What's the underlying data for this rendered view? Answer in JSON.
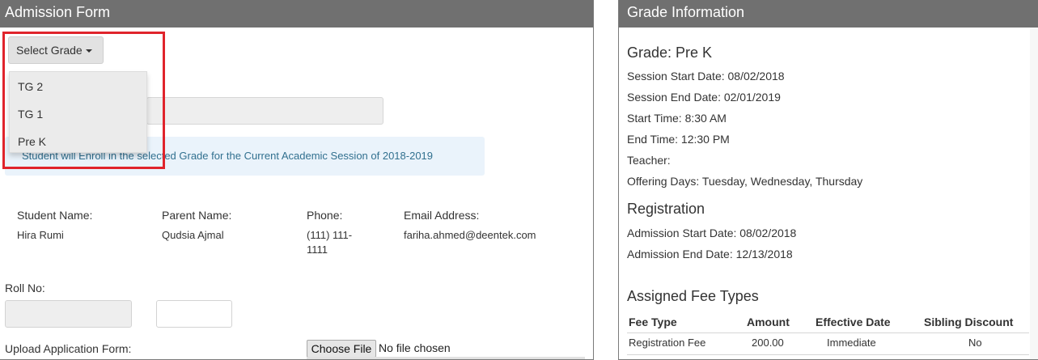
{
  "admission": {
    "title": "Admission Form",
    "select_grade_label": "Select Grade",
    "grade_options": [
      "TG 2",
      "TG 1",
      "Pre K"
    ],
    "enroll_notice": "Student will Enroll in the selected Grade for the Current Academic Session of 2018-2019",
    "student": {
      "name_label": "Student Name:",
      "name_value": "Hira Rumi",
      "parent_label": "Parent Name:",
      "parent_value": "Qudsia Ajmal",
      "phone_label": "Phone:",
      "phone_value_line1": "(111) 111-",
      "phone_value_line2": "1111",
      "email_label": "Email Address:",
      "email_value": "fariha.ahmed@deentek.com"
    },
    "roll_no_label": "Roll No:",
    "upload_label": "Upload Application Form:",
    "choose_file_label": "Choose File",
    "no_file_text": "No file chosen"
  },
  "grade_info": {
    "title": "Grade Information",
    "grade": "Grade: Pre K",
    "session_start": "Session Start Date: 08/02/2018",
    "session_end": "Session End Date: 02/01/2019",
    "start_time": "Start Time: 8:30 AM",
    "end_time": "End Time: 12:30 PM",
    "teacher": "Teacher:",
    "offering_days": "Offering Days: Tuesday, Wednesday, Thursday",
    "registration_heading": "Registration",
    "admission_start": "Admission Start Date: 08/02/2018",
    "admission_end": "Admission End Date: 12/13/2018",
    "fee_heading": "Assigned Fee Types",
    "fee_columns": [
      "Fee Type",
      "Amount",
      "Effective Date",
      "Sibling Discount"
    ],
    "fee_rows": [
      [
        "Registration Fee",
        "200.00",
        "Immediate",
        "No"
      ]
    ]
  },
  "colors": {
    "header_bg": "#707070",
    "highlight": "#e0242c",
    "alert_text": "#31708f",
    "alert_bg": "#eaf3fb"
  }
}
